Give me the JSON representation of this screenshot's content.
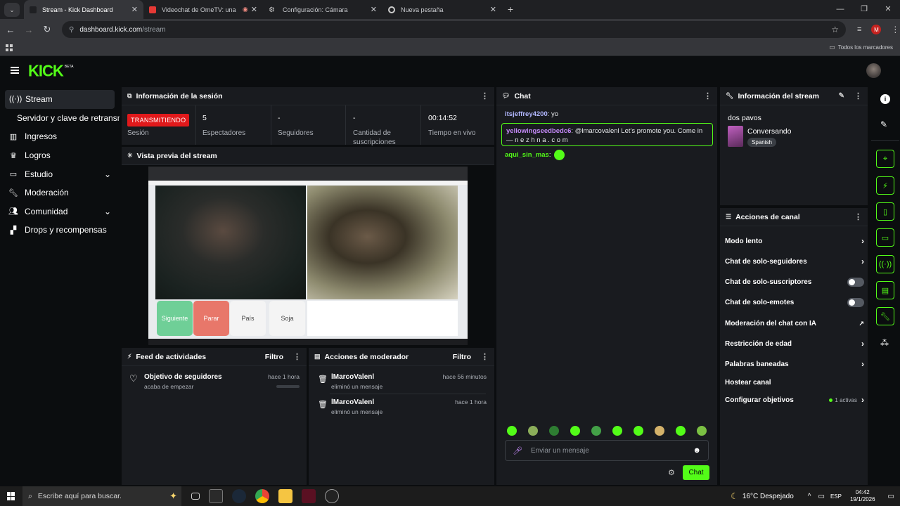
{
  "browser": {
    "tabs": [
      {
        "title": "Stream - Kick Dashboard",
        "active": true
      },
      {
        "title": "Videochat de OmeTV: una",
        "active": false
      },
      {
        "title": "Configuración: Cámara",
        "active": false
      },
      {
        "title": "Nueva pestaña",
        "active": false
      }
    ],
    "url_host": "dashboard.kick.com",
    "url_path": "/stream",
    "profile_initial": "M",
    "bookmarks_label": "Todos los marcadores"
  },
  "kick": {
    "logo": "KICK",
    "beta": "BETA"
  },
  "sidebar": {
    "items": [
      {
        "label": "Stream",
        "icon": "broadcast-icon"
      },
      {
        "label": "Servidor y clave de retransmisión",
        "icon": ""
      },
      {
        "label": "Ingresos",
        "icon": "chart-icon"
      },
      {
        "label": "Logros",
        "icon": "trophy-icon"
      },
      {
        "label": "Estudio",
        "icon": "studio-icon"
      },
      {
        "label": "Moderación",
        "icon": "wrench-icon"
      },
      {
        "label": "Comunidad",
        "icon": "users-icon"
      },
      {
        "label": "Drops y recompensas",
        "icon": "gift-icon"
      }
    ]
  },
  "session": {
    "title": "Información de la sesión",
    "status_badge": "TRANSMITIENDO",
    "status_label": "Sesión",
    "viewers_value": "5",
    "viewers_label": "Espectadores",
    "followers_value": "-",
    "followers_label": "Seguidores",
    "subs_value": "-",
    "subs_label": "Cantidad de suscripciones",
    "uptime_value": "00:14:52",
    "uptime_label": "Tiempo en vivo"
  },
  "preview": {
    "title": "Vista previa del stream",
    "buttons": [
      "Siguiente",
      "Parar",
      "País",
      "Soja"
    ]
  },
  "activity": {
    "title": "Feed de actividades",
    "filter": "Filtro",
    "items": [
      {
        "title": "Objetivo de seguidores",
        "sub": "acaba de empezar",
        "time": "hace 1 hora"
      }
    ]
  },
  "modactions": {
    "title": "Acciones de moderador",
    "filter": "Filtro",
    "items": [
      {
        "user": "lMarcoValenl",
        "action": "eliminó un mensaje",
        "time": "hace 56 minutos"
      },
      {
        "user": "lMarcoValenl",
        "action": "eliminó un mensaje",
        "time": "hace 1 hora"
      }
    ]
  },
  "chat": {
    "title": "Chat",
    "messages": [
      {
        "user": "itsjeffrey4200",
        "text": "yo",
        "color": "#b3b8ff"
      },
      {
        "user": "yellowingseedbedc6",
        "text": "@lmarcovalenl Let's promote you. Come in — n e z h n a . c o m",
        "color": "#c58af9"
      },
      {
        "user": "aqui_sin_mas",
        "text": "",
        "color": "#53fc18"
      }
    ],
    "placeholder": "Enviar un mensaje",
    "send_label": "Chat"
  },
  "stream_info": {
    "title": "Información del stream",
    "stream_title": "dos pavos",
    "category": "Conversando",
    "language": "Spanish"
  },
  "channel_actions": {
    "title": "Acciones de canal",
    "slow_mode": "Modo lento",
    "followers_only": "Chat de solo-seguidores",
    "subs_only": "Chat de solo-suscriptores",
    "emotes_only": "Chat de solo-emotes",
    "ai_mod": "Moderación del chat con IA",
    "age_restriction": "Restricción de edad",
    "banned_words": "Palabras baneadas",
    "host": "Hostear canal",
    "goals": "Configurar objetivos",
    "goals_active": "1 activas"
  },
  "taskbar": {
    "search_placeholder": "Escribe aquí para buscar.",
    "weather": "16°C  Despejado",
    "lang": "ESP",
    "time": "04:42",
    "date": "19/1/2026"
  },
  "colors": {
    "accent": "#53fc18",
    "live": "#e0191b"
  }
}
